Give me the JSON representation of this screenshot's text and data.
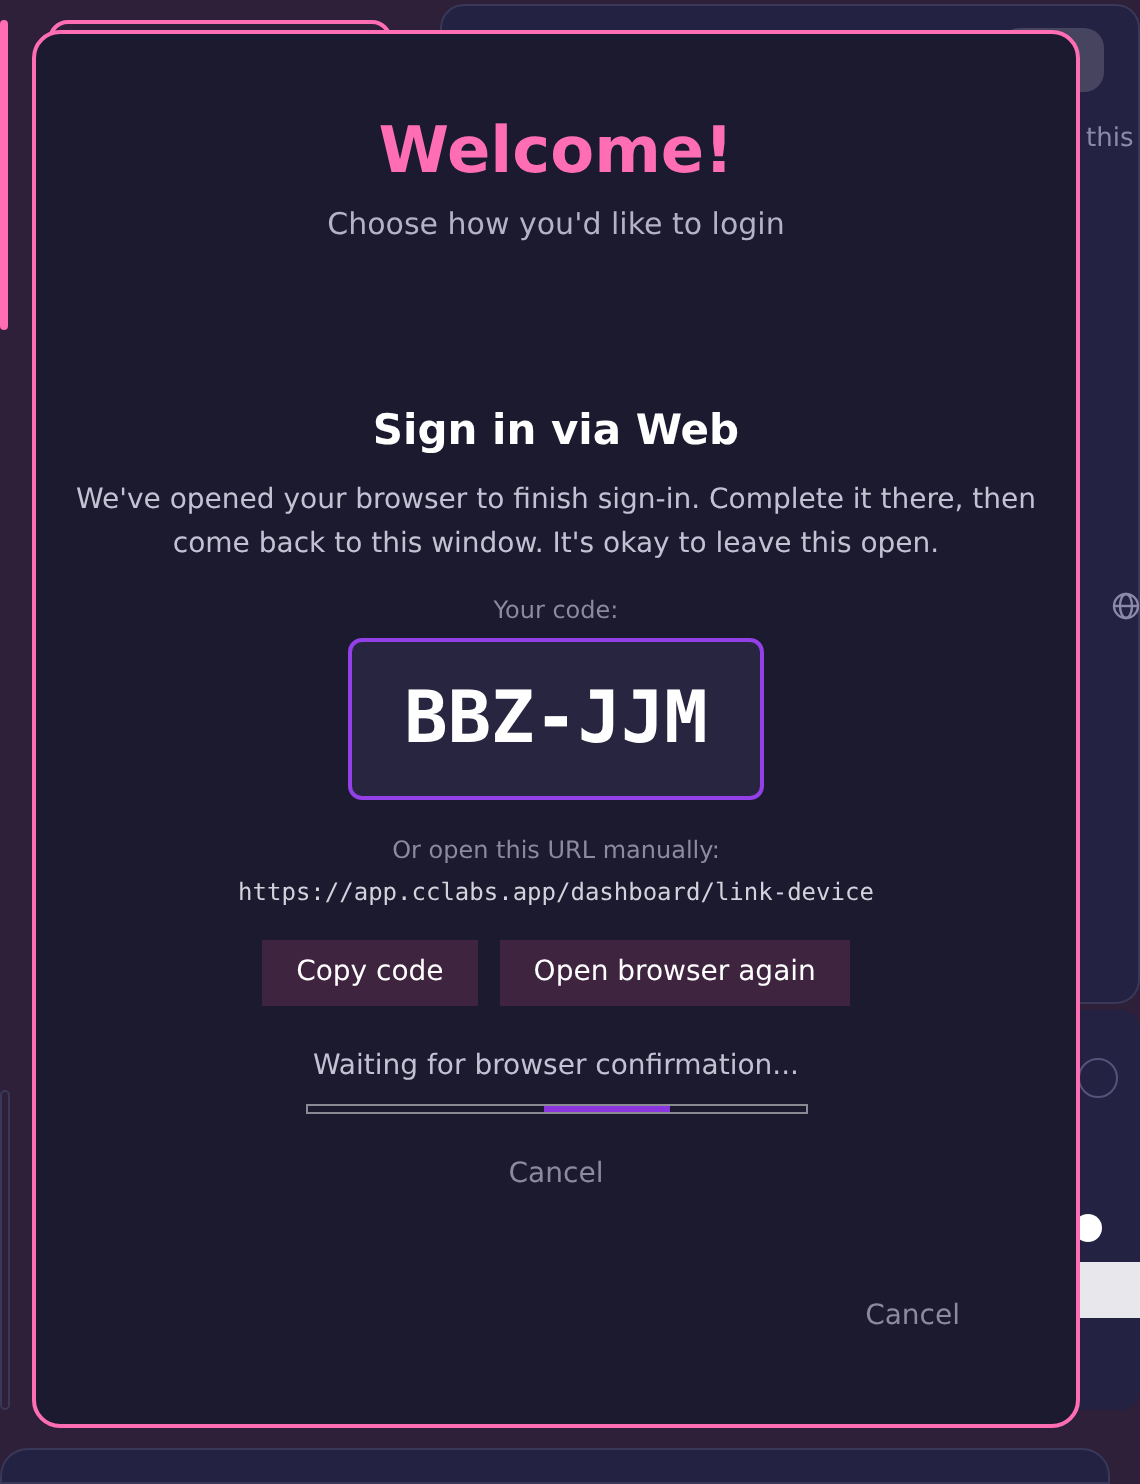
{
  "background": {
    "hint_fragment": "this"
  },
  "dialog": {
    "title": "Welcome!",
    "subtitle": "Choose how you'd like to login",
    "section_title": "Sign in via Web",
    "message": "We've opened your browser to finish sign-in. Complete it there, then come back to this window. It's okay to leave this open.",
    "code_label": "Your code:",
    "code": "BBZ-JJM",
    "url_label": "Or open this URL manually:",
    "url": "https://app.cclabs.app/dashboard/link-device",
    "buttons": [
      "Copy code",
      "Open browser again"
    ],
    "status": "Waiting for browser confirmation...",
    "cancel_link": "Cancel",
    "footer_cancel": "Cancel"
  }
}
